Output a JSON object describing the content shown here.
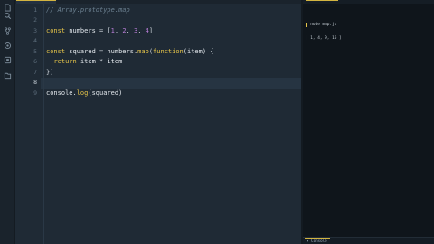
{
  "activity_bar": {
    "icons": [
      "files-icon",
      "search-icon",
      "source-control-icon",
      "debug-icon",
      "extensions-icon",
      "packages-icon"
    ]
  },
  "editor": {
    "current_line": 8,
    "lines": [
      {
        "no": "1",
        "tokens": [
          {
            "t": "// Array.prototype.map",
            "c": "tok-comment"
          }
        ]
      },
      {
        "no": "2",
        "tokens": []
      },
      {
        "no": "3",
        "tokens": [
          {
            "t": "const",
            "c": "tok-kw"
          },
          {
            "t": " numbers ",
            "c": "tok-id"
          },
          {
            "t": "=",
            "c": "tok-op"
          },
          {
            "t": " [",
            "c": "tok-punc"
          },
          {
            "t": "1",
            "c": "tok-num"
          },
          {
            "t": ", ",
            "c": "tok-punc"
          },
          {
            "t": "2",
            "c": "tok-num"
          },
          {
            "t": ", ",
            "c": "tok-punc"
          },
          {
            "t": "3",
            "c": "tok-num"
          },
          {
            "t": ", ",
            "c": "tok-punc"
          },
          {
            "t": "4",
            "c": "tok-num"
          },
          {
            "t": "]",
            "c": "tok-punc"
          }
        ]
      },
      {
        "no": "4",
        "tokens": []
      },
      {
        "no": "5",
        "tokens": [
          {
            "t": "const",
            "c": "tok-kw"
          },
          {
            "t": " squared ",
            "c": "tok-id"
          },
          {
            "t": "=",
            "c": "tok-op"
          },
          {
            "t": " numbers.",
            "c": "tok-id"
          },
          {
            "t": "map",
            "c": "tok-fn"
          },
          {
            "t": "(",
            "c": "tok-punc"
          },
          {
            "t": "function",
            "c": "tok-kw"
          },
          {
            "t": "(item) {",
            "c": "tok-id"
          }
        ]
      },
      {
        "no": "6",
        "tokens": [
          {
            "t": "  ",
            "c": "tok-id"
          },
          {
            "t": "return",
            "c": "tok-kw"
          },
          {
            "t": " item ",
            "c": "tok-id"
          },
          {
            "t": "*",
            "c": "tok-op"
          },
          {
            "t": " item",
            "c": "tok-id"
          }
        ]
      },
      {
        "no": "7",
        "tokens": [
          {
            "t": "})",
            "c": "tok-punc"
          }
        ]
      },
      {
        "no": "8",
        "tokens": []
      },
      {
        "no": "9",
        "tokens": [
          {
            "t": "console.",
            "c": "tok-id"
          },
          {
            "t": "log",
            "c": "tok-fn"
          },
          {
            "t": "(squared)",
            "c": "tok-id"
          }
        ]
      }
    ]
  },
  "console": {
    "output_lines": [
      "▸ node map.js",
      "[ 1, 4, 9, 16 ]"
    ],
    "tab_label": "▾ Console"
  },
  "colors": {
    "accent": "#d3b440",
    "keyword": "#e5c449",
    "number": "#b77dd6",
    "comment": "#6c8191",
    "editor_bg": "#1f2a35",
    "console_bg": "#0f151b"
  }
}
